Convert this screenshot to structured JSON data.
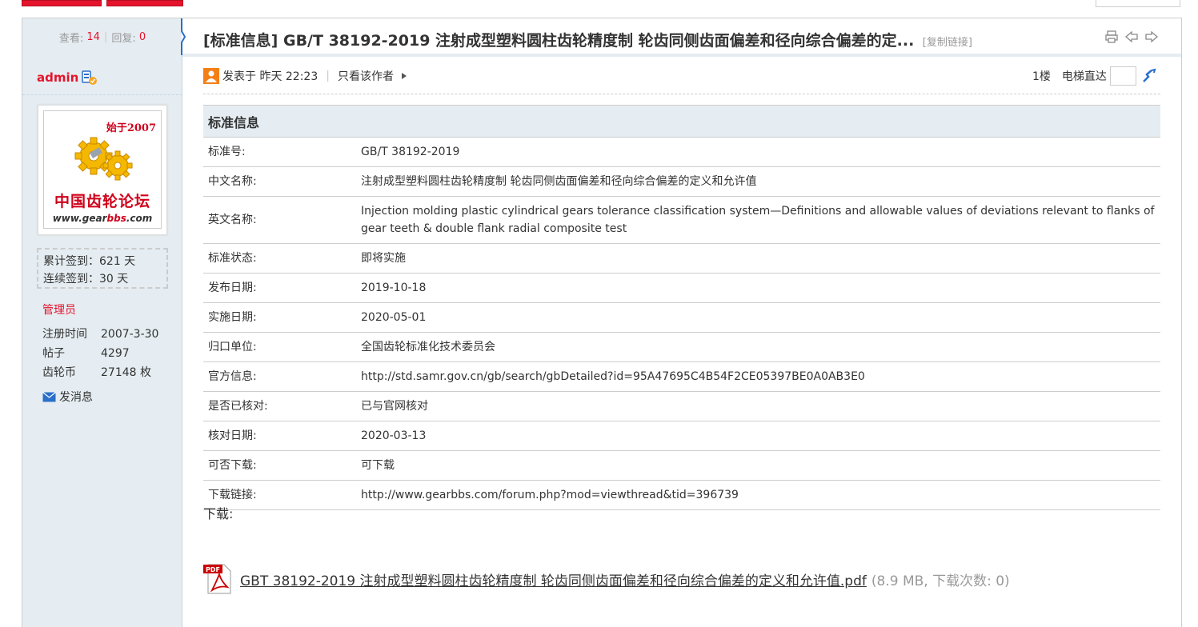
{
  "thread": {
    "views_label": "查看:",
    "views": "14",
    "replies_label": "回复:",
    "replies": "0",
    "title": "[标准信息] GB/T 38192-2019 注射成型塑料圆柱齿轮精度制 轮齿同侧齿面偏差和径向综合偏差的定...",
    "copy_link": "[复制链接]"
  },
  "author": {
    "name": "admin",
    "avatar": {
      "since": "始于2007",
      "site_name": "中国齿轮论坛",
      "url_prefix": "www.gear",
      "url_highlight": "bbs",
      "url_suffix": ".com"
    },
    "sign_total": "累计签到：621 天",
    "sign_streak": "连续签到：30 天",
    "role": "管理员",
    "info": [
      {
        "key": "注册时间",
        "value": "2007-3-30"
      },
      {
        "key": "帖子",
        "value": "4297"
      },
      {
        "key": "齿轮币",
        "value": "27148 枚"
      }
    ],
    "send_message": "发消息"
  },
  "post": {
    "posted_at": "发表于 昨天 22:23",
    "only_author": "只看该作者",
    "floor": "1楼",
    "elevator": "电梯直达"
  },
  "standard_table": {
    "heading": "标准信息",
    "rows": [
      {
        "key": "标准号:",
        "value": "GB/T 38192-2019"
      },
      {
        "key": "中文名称:",
        "value": "注射成型塑料圆柱齿轮精度制 轮齿同侧齿面偏差和径向综合偏差的定义和允许值"
      },
      {
        "key": "英文名称:",
        "value": "Injection molding plastic cylindrical gears tolerance classification system—Definitions and allowable values of deviations relevant to flanks of gear teeth & double flank radial composite test"
      },
      {
        "key": "标准状态:",
        "value": "即将实施"
      },
      {
        "key": "发布日期:",
        "value": "2019-10-18"
      },
      {
        "key": "实施日期:",
        "value": "2020-05-01"
      },
      {
        "key": "归口单位:",
        "value": "全国齿轮标准化技术委员会"
      },
      {
        "key": "官方信息:",
        "value": "http://std.samr.gov.cn/gb/search/gbDetailed?id=95A47695C4B54F2CE05397BE0A0AB3E0"
      },
      {
        "key": "是否已核对:",
        "value": "已与官网核对"
      },
      {
        "key": "核对日期:",
        "value": "2020-03-13"
      },
      {
        "key": "可否下载:",
        "value": "可下载"
      },
      {
        "key": "下载链接:",
        "value": "http://www.gearbbs.com/forum.php?mod=viewthread&tid=396739"
      }
    ]
  },
  "download": {
    "label": "下载:",
    "file_name": "GBT 38192-2019 注射成型塑料圆柱齿轮精度制 轮齿同侧齿面偏差和径向综合偏差的定义和允许值.pdf",
    "file_meta": "(8.9 MB, 下载次数: 0)",
    "file_icon": "pdf-icon",
    "pdf_badge": "PDF"
  },
  "colors": {
    "accent_red": "#e5132b",
    "sidebar_bg": "#e5edf2",
    "link_blue": "#2a6fc9"
  }
}
